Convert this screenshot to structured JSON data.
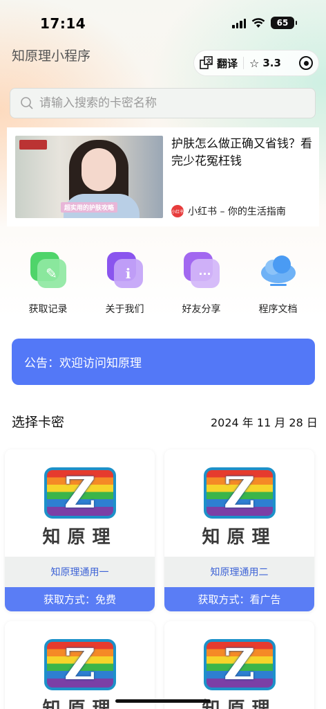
{
  "status_bar": {
    "time": "17:14",
    "battery": "65"
  },
  "header": {
    "title": "知原理小程序",
    "translate_label": "翻译",
    "rating": "3.3"
  },
  "search": {
    "placeholder": "请输入搜索的卡密名称"
  },
  "ad": {
    "title": "护肤怎么做正确又省钱？看完少花冤枉钱",
    "brand_logo_text": "小红书",
    "brand": "小红书 – 你的生活指南",
    "thumb_caption": "超实用的护肤攻略"
  },
  "grid": [
    {
      "label": "获取记录",
      "icon": "pencil-icon",
      "color_back": "#4fd46a",
      "color_front": "#8fe8a2",
      "glyph": "✎"
    },
    {
      "label": "关于我们",
      "icon": "info-icon",
      "color_back": "#8a55ee",
      "color_front": "#c3a4f7",
      "glyph": "i"
    },
    {
      "label": "好友分享",
      "icon": "share-icon",
      "color_back": "#a268f0",
      "color_front": "#d2b6f9",
      "glyph": "···"
    },
    {
      "label": "程序文档",
      "icon": "cloud-icon",
      "color_back": "#3f93f3",
      "color_front": "#9ccaf8",
      "glyph": ""
    }
  ],
  "notice": "公告：欢迎访问知原理",
  "section": {
    "title": "选择卡密",
    "date": "2024 年 11 月 28 日"
  },
  "cards": [
    {
      "logo_letter": "Z",
      "brand": "知原理",
      "name": "知原理通用一",
      "method": "获取方式：免费"
    },
    {
      "logo_letter": "Z",
      "brand": "知原理",
      "name": "知原理通用二",
      "method": "获取方式：看广告"
    },
    {
      "logo_letter": "Z",
      "brand": "知原理"
    },
    {
      "logo_letter": "Z",
      "brand": "知原理"
    }
  ],
  "colors": {
    "accent": "#5378f7",
    "card_button": "#5a7df5",
    "card_name_text": "#3e63d6"
  }
}
